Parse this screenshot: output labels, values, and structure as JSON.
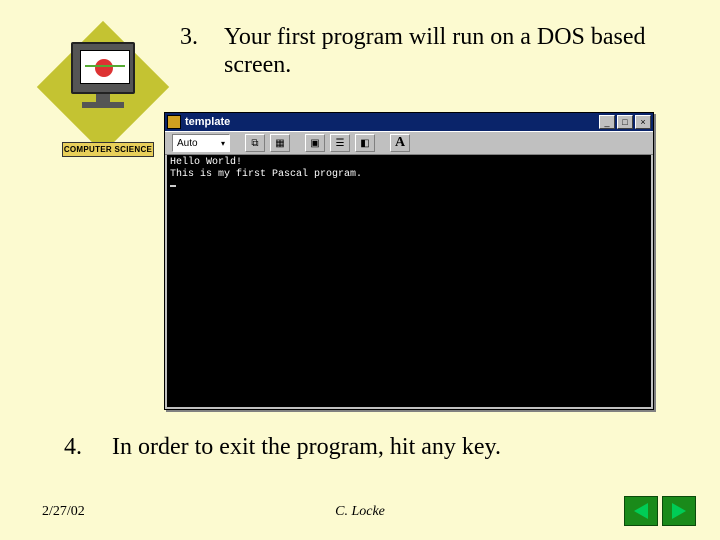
{
  "logo_label": "COMPUTER SCIENCE",
  "points": {
    "p3": {
      "num": "3.",
      "text": "Your first program will run on a DOS based screen."
    },
    "p4": {
      "num": "4.",
      "text": "In order to exit the program, hit any key."
    }
  },
  "dos_window": {
    "title": "template",
    "buttons": {
      "min": "_",
      "max": "□",
      "close": "×"
    },
    "toolbar": {
      "auto": "Auto",
      "font_glyph": "A"
    },
    "output_lines": [
      "Hello World!",
      "This is my first Pascal program."
    ]
  },
  "footer": {
    "date": "2/27/02",
    "author": "C. Locke"
  }
}
